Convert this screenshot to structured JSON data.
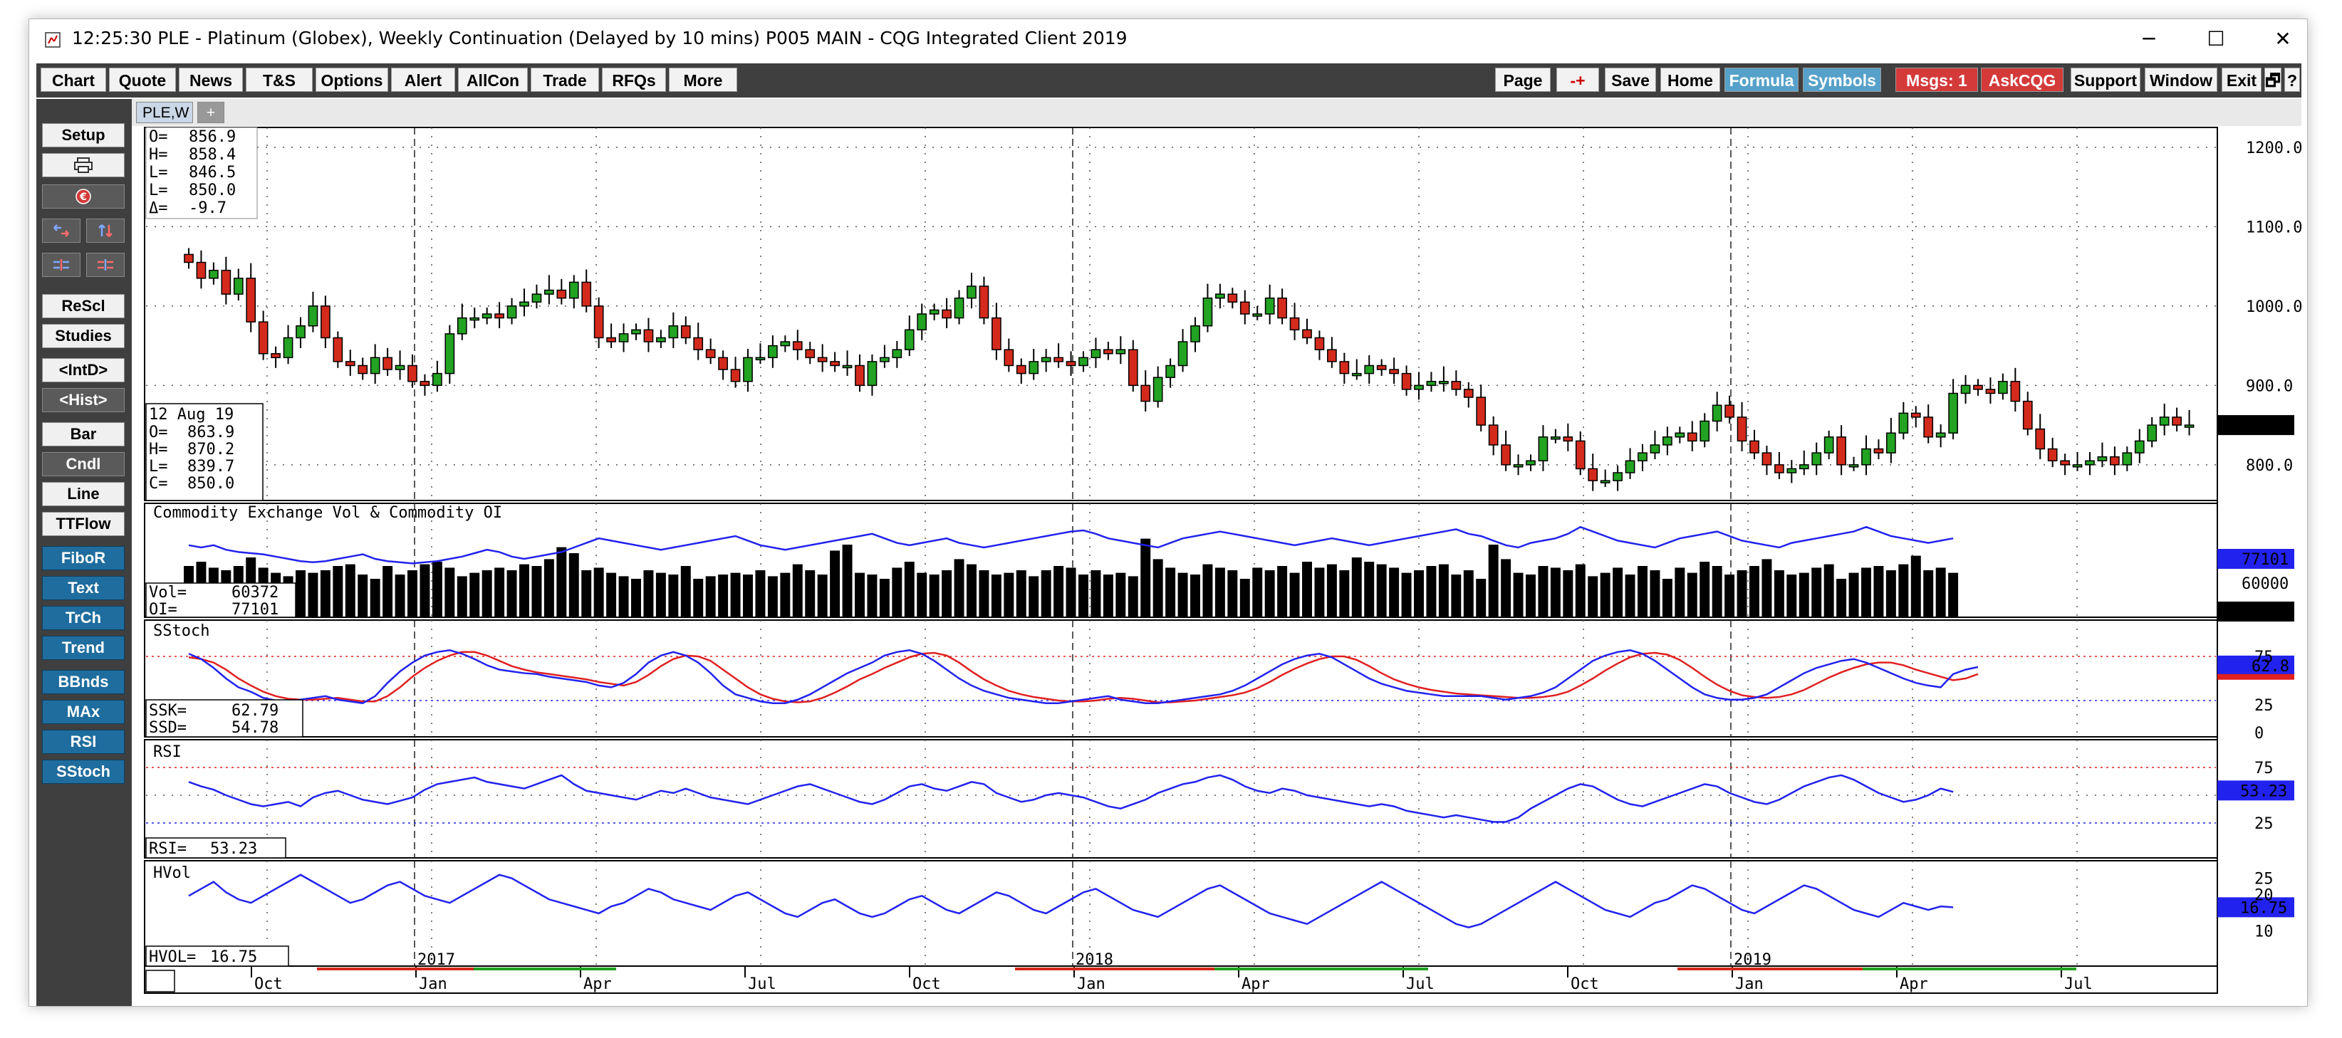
{
  "window": {
    "clock": "12:25:30",
    "title": "PLE - Platinum (Globex), Weekly Continuation (Delayed by 10 mins)  P005 MAIN - CQG Integrated Client 2019",
    "minimize": "─",
    "maximize": "☐",
    "close": "✕"
  },
  "menubar": {
    "left": [
      "Chart",
      "Quote",
      "News",
      "T&S",
      "Options",
      "Alert",
      "AllCon",
      "Trade",
      "RFQs",
      "More"
    ],
    "right": {
      "page": "Page",
      "pm": "-+",
      "save": "Save",
      "home": "Home",
      "formula": "Formula",
      "symbols": "Symbols",
      "msgs": "Msgs: 1",
      "askcqg": "AskCQG",
      "support": "Support",
      "window": "Window",
      "exit": "Exit",
      "restore": "🗗",
      "help": "?"
    }
  },
  "sidebar": {
    "setup": "Setup",
    "rescl": "ReScl",
    "studies": "Studies",
    "intd": "<IntD>",
    "hist": "<Hist>",
    "bar": "Bar",
    "cndl": "Cndl",
    "line": "Line",
    "ttflow": "TTFlow",
    "fibor": "FiboR",
    "text": "Text",
    "trch": "TrCh",
    "trend": "Trend",
    "bbnds": "BBnds",
    "max": "MAx",
    "rsi": "RSI",
    "sstoch": "SStoch"
  },
  "tabs": {
    "active": "PLE,W",
    "add": "+"
  },
  "colors": {
    "up": "#22a322",
    "down": "#d42a1c",
    "blueline": "#2222ee",
    "redline": "#e02020",
    "accent_red": "#d43a3a",
    "accent_blue": "#56a1c9"
  },
  "price_panel": {
    "ohlc_top": [
      {
        "k": "O=",
        "v": "856.9"
      },
      {
        "k": "H=",
        "v": "858.4"
      },
      {
        "k": "L=",
        "v": "846.5"
      },
      {
        "k": "L=",
        "v": "850.0"
      },
      {
        "k": "Δ=",
        "v": "-9.7"
      }
    ],
    "cursor_date": "12 Aug 19",
    "ohlc_cursor": [
      {
        "k": "O=",
        "v": "863.9"
      },
      {
        "k": "H=",
        "v": "870.2"
      },
      {
        "k": "L=",
        "v": "839.7"
      },
      {
        "k": "C=",
        "v": "850.0"
      }
    ],
    "yticks": [
      1200,
      1100,
      1000,
      900,
      800
    ],
    "ytick_labels": [
      "1200.0",
      "1100.0",
      "1000.0",
      "900.0",
      "800.0"
    ],
    "ylim": [
      755,
      1225
    ],
    "last_label": "850.0"
  },
  "volume_panel": {
    "title": "Commodity Exchange Vol & Commodity OI",
    "vol_label": "Vol=",
    "vol_value": "60372",
    "oi_label": "OI=",
    "oi_value": "77101",
    "ytick_label": "60000",
    "last_oi": "77101",
    "last_vol": "60372"
  },
  "stoch_panel": {
    "title": "SStoch",
    "ssk_label": "SSK=",
    "ssk_value": "62.79",
    "ssd_label": "SSD=",
    "ssd_value": "54.78",
    "ytick_labels": [
      "75",
      "25",
      "0"
    ],
    "last_label": "62.8"
  },
  "rsi_panel": {
    "title": "RSI",
    "rsi_label": "RSI=",
    "rsi_value": "53.23",
    "ytick_labels": [
      "75",
      "25"
    ],
    "last_label": "53.23"
  },
  "hvol_panel": {
    "title": "HVol",
    "hvol_label": "HVOL=",
    "hvol_value": "16.75",
    "ytick_labels": [
      "25",
      "20",
      "10"
    ],
    "last_label": "16.75"
  },
  "time_axis": {
    "years": [
      "2017",
      "2018",
      "2019"
    ],
    "months": [
      "Oct",
      "Jan",
      "Apr",
      "Jul",
      "Oct",
      "Jan",
      "Apr",
      "Jul",
      "Oct",
      "Jan",
      "Apr",
      "Jul"
    ]
  },
  "chart_data": {
    "type": "candlestick",
    "title": "PLE - Platinum (Globex), Weekly Continuation",
    "ylim": [
      755,
      1225
    ],
    "weeks": 143,
    "close": [
      1055,
      1035,
      1045,
      1015,
      1035,
      980,
      940,
      935,
      960,
      975,
      1000,
      960,
      930,
      925,
      915,
      935,
      920,
      925,
      905,
      900,
      915,
      965,
      985,
      985,
      990,
      985,
      1000,
      1005,
      1015,
      1020,
      1010,
      1030,
      1000,
      960,
      955,
      965,
      970,
      955,
      960,
      975,
      960,
      945,
      935,
      920,
      905,
      935,
      935,
      950,
      955,
      945,
      935,
      930,
      925,
      925,
      900,
      930,
      935,
      945,
      970,
      990,
      995,
      985,
      1010,
      1025,
      985,
      945,
      925,
      915,
      930,
      935,
      930,
      925,
      935,
      945,
      940,
      945,
      900,
      880,
      910,
      925,
      955,
      975,
      1010,
      1015,
      1005,
      990,
      990,
      1010,
      985,
      970,
      960,
      945,
      930,
      915,
      915,
      925,
      920,
      915,
      895,
      900,
      905,
      905,
      895,
      885,
      850,
      825,
      800,
      800,
      805,
      835,
      835,
      830,
      795,
      780,
      780,
      790,
      805,
      815,
      825,
      835,
      840,
      830,
      855,
      875,
      860,
      830,
      815,
      800,
      790,
      795,
      800,
      815,
      835,
      800,
      800,
      820,
      815,
      840,
      865,
      860,
      835,
      840,
      890,
      900,
      895,
      890,
      905,
      880,
      845,
      820,
      805,
      800,
      800,
      805,
      810,
      800,
      815,
      830,
      850,
      860,
      850,
      850
    ],
    "volume": [
      60,
      65,
      58,
      55,
      60,
      70,
      58,
      52,
      48,
      55,
      52,
      55,
      60,
      62,
      50,
      45,
      60,
      50,
      55,
      62,
      65,
      58,
      48,
      52,
      55,
      58,
      55,
      62,
      60,
      68,
      82,
      75,
      55,
      58,
      52,
      48,
      45,
      55,
      52,
      50,
      60,
      45,
      48,
      50,
      52,
      50,
      55,
      48,
      52,
      62,
      55,
      50,
      78,
      85,
      52,
      50,
      45,
      58,
      65,
      52,
      50,
      55,
      68,
      62,
      55,
      50,
      52,
      55,
      48,
      55,
      60,
      58,
      50,
      55,
      50,
      52,
      48,
      92,
      68,
      58,
      52,
      50,
      62,
      58,
      55,
      45,
      58,
      55,
      60,
      52,
      65,
      58,
      62,
      55,
      70,
      65,
      62,
      58,
      52,
      55,
      60,
      62,
      50,
      55,
      45,
      85,
      68,
      52,
      50,
      60,
      58,
      55,
      62,
      48,
      52,
      58,
      50,
      60,
      55,
      45,
      58,
      52,
      65,
      60,
      50,
      55,
      60,
      68,
      55,
      50,
      52,
      58,
      62,
      45,
      52,
      58,
      60,
      55,
      62,
      72,
      55,
      58,
      52
    ],
    "oi": [
      82,
      80,
      82,
      78,
      76,
      75,
      74,
      72,
      70,
      68,
      67,
      68,
      70,
      72,
      74,
      70,
      68,
      67,
      66,
      67,
      68,
      70,
      72,
      75,
      78,
      76,
      72,
      70,
      72,
      74,
      76,
      80,
      84,
      88,
      86,
      84,
      82,
      80,
      78,
      80,
      82,
      84,
      86,
      88,
      90,
      86,
      82,
      80,
      78,
      80,
      82,
      84,
      86,
      88,
      90,
      92,
      88,
      84,
      82,
      84,
      86,
      88,
      84,
      82,
      80,
      82,
      84,
      86,
      88,
      90,
      92,
      94,
      95,
      92,
      88,
      86,
      84,
      82,
      80,
      84,
      88,
      90,
      92,
      94,
      92,
      90,
      88,
      86,
      84,
      82,
      84,
      86,
      88,
      86,
      84,
      82,
      84,
      86,
      88,
      90,
      92,
      94,
      96,
      92,
      90,
      86,
      82,
      80,
      84,
      86,
      88,
      92,
      98,
      94,
      90,
      86,
      84,
      82,
      80,
      84,
      88,
      90,
      92,
      94,
      90,
      86,
      84,
      82,
      80,
      84,
      86,
      88,
      90,
      92,
      94,
      98,
      94,
      90,
      88,
      86,
      84,
      86,
      88
    ],
    "sstoch_k": [
      78,
      72,
      62,
      50,
      40,
      35,
      28,
      25,
      24,
      26,
      28,
      30,
      26,
      24,
      22,
      30,
      45,
      58,
      68,
      76,
      80,
      82,
      78,
      72,
      65,
      60,
      58,
      56,
      55,
      52,
      50,
      48,
      46,
      42,
      40,
      45,
      55,
      68,
      76,
      80,
      76,
      68,
      56,
      42,
      32,
      28,
      24,
      22,
      22,
      26,
      32,
      40,
      48,
      56,
      62,
      68,
      76,
      80,
      82,
      78,
      70,
      60,
      50,
      42,
      36,
      32,
      28,
      26,
      24,
      22,
      22,
      24,
      26,
      28,
      30,
      26,
      24,
      22,
      22,
      24,
      26,
      28,
      30,
      32,
      36,
      42,
      50,
      58,
      66,
      72,
      76,
      78,
      74,
      66,
      58,
      50,
      44,
      40,
      36,
      34,
      32,
      30,
      30,
      30,
      30,
      28,
      26,
      28,
      30,
      34,
      40,
      50,
      60,
      70,
      76,
      80,
      82,
      78,
      70,
      60,
      50,
      40,
      32,
      28,
      26,
      26,
      28,
      32,
      40,
      48,
      56,
      62,
      66,
      70,
      72,
      68,
      62,
      56,
      50,
      45,
      42,
      40,
      55,
      60,
      63
    ],
    "sstoch_d": [
      74,
      72,
      68,
      60,
      50,
      42,
      35,
      30,
      27,
      26,
      26,
      27,
      28,
      26,
      24,
      24,
      30,
      40,
      52,
      62,
      70,
      76,
      80,
      80,
      76,
      70,
      64,
      60,
      57,
      55,
      53,
      51,
      49,
      46,
      44,
      42,
      46,
      54,
      64,
      72,
      76,
      75,
      70,
      60,
      50,
      40,
      32,
      27,
      24,
      23,
      24,
      28,
      34,
      41,
      49,
      55,
      62,
      68,
      74,
      78,
      79,
      76,
      68,
      58,
      49,
      42,
      36,
      32,
      29,
      27,
      25,
      24,
      24,
      25,
      27,
      28,
      27,
      25,
      23,
      23,
      24,
      25,
      27,
      29,
      31,
      34,
      39,
      46,
      54,
      61,
      67,
      72,
      75,
      75,
      71,
      64,
      56,
      49,
      44,
      40,
      37,
      35,
      33,
      32,
      31,
      30,
      29,
      28,
      28,
      29,
      31,
      35,
      42,
      50,
      59,
      67,
      74,
      78,
      79,
      77,
      71,
      62,
      52,
      43,
      36,
      31,
      29,
      28,
      29,
      32,
      37,
      44,
      51,
      57,
      62,
      66,
      68,
      68,
      65,
      60,
      56,
      52,
      48,
      50,
      55
    ],
    "rsi": [
      62,
      58,
      55,
      50,
      46,
      42,
      40,
      42,
      44,
      40,
      48,
      52,
      54,
      50,
      46,
      44,
      42,
      45,
      48,
      55,
      60,
      62,
      64,
      66,
      62,
      60,
      58,
      56,
      60,
      64,
      68,
      60,
      54,
      52,
      50,
      48,
      46,
      50,
      54,
      52,
      56,
      52,
      48,
      46,
      44,
      42,
      46,
      50,
      54,
      58,
      60,
      56,
      52,
      48,
      44,
      42,
      46,
      52,
      58,
      60,
      56,
      54,
      58,
      62,
      60,
      52,
      48,
      44,
      46,
      50,
      52,
      50,
      48,
      44,
      40,
      38,
      42,
      46,
      52,
      56,
      60,
      62,
      66,
      68,
      64,
      58,
      54,
      52,
      56,
      54,
      50,
      48,
      46,
      44,
      42,
      40,
      42,
      40,
      36,
      34,
      32,
      30,
      32,
      30,
      28,
      26,
      26,
      30,
      38,
      44,
      50,
      56,
      60,
      58,
      52,
      46,
      42,
      40,
      44,
      48,
      52,
      56,
      60,
      58,
      52,
      48,
      44,
      42,
      46,
      52,
      58,
      62,
      66,
      68,
      64,
      58,
      52,
      48,
      44,
      46,
      50,
      56,
      53
    ],
    "hvol": [
      20,
      22,
      24,
      21,
      19,
      18,
      20,
      22,
      24,
      26,
      24,
      22,
      20,
      18,
      19,
      21,
      23,
      24,
      22,
      20,
      19,
      18,
      20,
      22,
      24,
      26,
      25,
      23,
      21,
      19,
      18,
      17,
      16,
      15,
      17,
      18,
      20,
      22,
      21,
      19,
      18,
      17,
      16,
      18,
      20,
      21,
      19,
      17,
      15,
      14,
      16,
      18,
      19,
      17,
      15,
      14,
      15,
      17,
      19,
      20,
      18,
      16,
      15,
      17,
      19,
      21,
      20,
      18,
      16,
      15,
      17,
      19,
      21,
      22,
      20,
      18,
      16,
      15,
      14,
      16,
      18,
      20,
      22,
      23,
      21,
      19,
      17,
      15,
      14,
      13,
      12,
      14,
      16,
      18,
      20,
      22,
      24,
      22,
      20,
      18,
      16,
      14,
      12,
      11,
      12,
      14,
      16,
      18,
      20,
      22,
      24,
      22,
      20,
      18,
      16,
      15,
      14,
      16,
      18,
      19,
      21,
      23,
      22,
      20,
      18,
      16,
      15,
      17,
      19,
      21,
      23,
      22,
      20,
      18,
      16,
      15,
      14,
      16,
      18,
      17,
      16,
      17,
      16.75
    ],
    "xlabel": "",
    "ylabel": ""
  }
}
